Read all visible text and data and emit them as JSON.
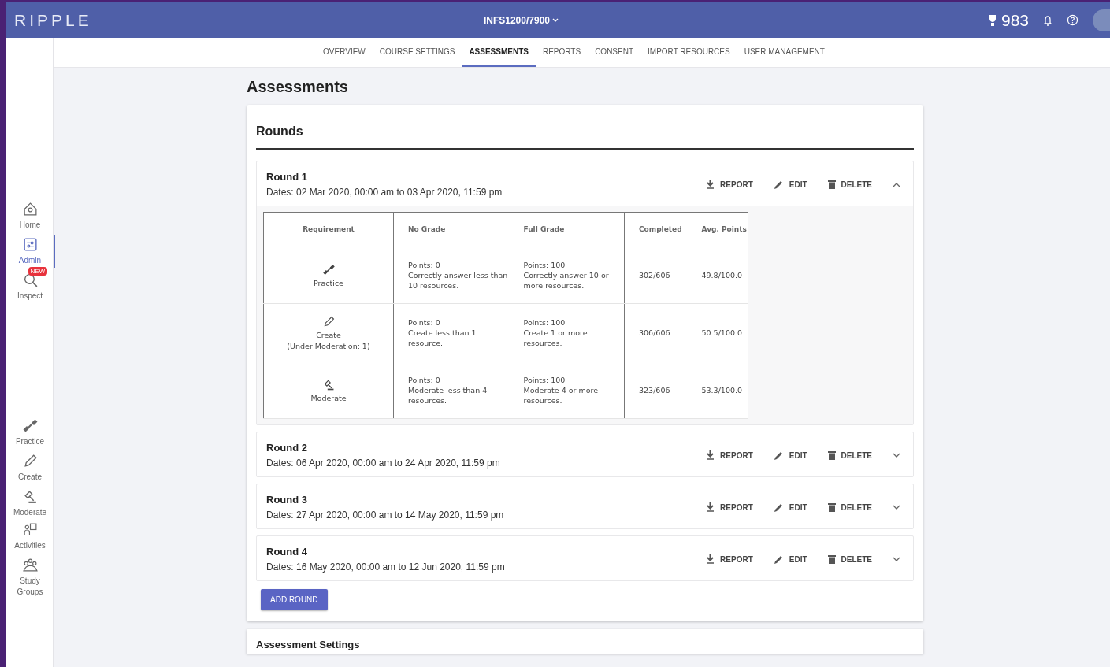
{
  "header": {
    "logo": "RIPPLE",
    "course": "INFS1200/7900",
    "points": "983"
  },
  "sidebar": {
    "groups": [
      [
        {
          "label": "Home",
          "selected": false
        },
        {
          "label": "Admin",
          "selected": true
        },
        {
          "label": "Inspect",
          "selected": false,
          "badge": "NEW"
        }
      ],
      [
        {
          "label": "Practice",
          "selected": false
        },
        {
          "label": "Create",
          "selected": false
        },
        {
          "label": "Moderate",
          "selected": false
        }
      ],
      [
        {
          "label": "Activities",
          "selected": false
        },
        {
          "label": "Study Groups",
          "selected": false
        }
      ]
    ]
  },
  "tabs": [
    {
      "label": "OVERVIEW",
      "selected": false
    },
    {
      "label": "COURSE SETTINGS",
      "selected": false
    },
    {
      "label": "ASSESSMENTS",
      "selected": true
    },
    {
      "label": "REPORTS",
      "selected": false
    },
    {
      "label": "CONSENT",
      "selected": false
    },
    {
      "label": "IMPORT RESOURCES",
      "selected": false
    },
    {
      "label": "USER MANAGEMENT",
      "selected": false
    }
  ],
  "page_title": "Assessments",
  "rounds_card": {
    "title": "Rounds",
    "rounds": [
      {
        "name": "Round 1",
        "dates": "Dates: 02 Mar 2020, 00:00 am to 03 Apr 2020, 11:59 pm",
        "actions": [
          "REPORT",
          "EDIT",
          "DELETE"
        ],
        "expanded": true,
        "table": {
          "columns": [
            "Requirement",
            "No Grade",
            "Full Grade",
            "Completed",
            "Avg. Points"
          ],
          "rows": [
            {
              "requirement": "Practice",
              "no_grade": [
                "Points: 0",
                "Correctly answer less than 10 resources."
              ],
              "full_grade": [
                "Points: 100",
                "Correctly answer 10 or more resources."
              ],
              "completed": "302/606",
              "avg_points": "49.8/100.0"
            },
            {
              "requirement": "Create",
              "note": "(Under Moderation: 1)",
              "no_grade": [
                "Points: 0",
                "Create less than 1 resource."
              ],
              "full_grade": [
                "Points: 100",
                "Create 1 or more resources."
              ],
              "completed": "306/606",
              "avg_points": "50.5/100.0"
            },
            {
              "requirement": "Moderate",
              "no_grade": [
                "Points: 0",
                "Moderate less than 4 resources."
              ],
              "full_grade": [
                "Points: 100",
                "Moderate 4 or more resources."
              ],
              "completed": "323/606",
              "avg_points": "53.3/100.0"
            }
          ]
        }
      },
      {
        "name": "Round 2",
        "dates": "Dates: 06 Apr 2020, 00:00 am to 24 Apr 2020, 11:59 pm",
        "actions": [
          "REPORT",
          "EDIT",
          "DELETE"
        ],
        "expanded": false
      },
      {
        "name": "Round 3",
        "dates": "Dates: 27 Apr 2020, 00:00 am to 14 May 2020, 11:59 pm",
        "actions": [
          "REPORT",
          "EDIT",
          "DELETE"
        ],
        "expanded": false
      },
      {
        "name": "Round 4",
        "dates": "Dates: 16 May 2020, 00:00 am to 12 Jun 2020, 11:59 pm",
        "actions": [
          "REPORT",
          "EDIT",
          "DELETE"
        ],
        "expanded": false
      }
    ],
    "add_button": "ADD ROUND"
  },
  "settings_card": {
    "title": "Assessment Settings"
  }
}
